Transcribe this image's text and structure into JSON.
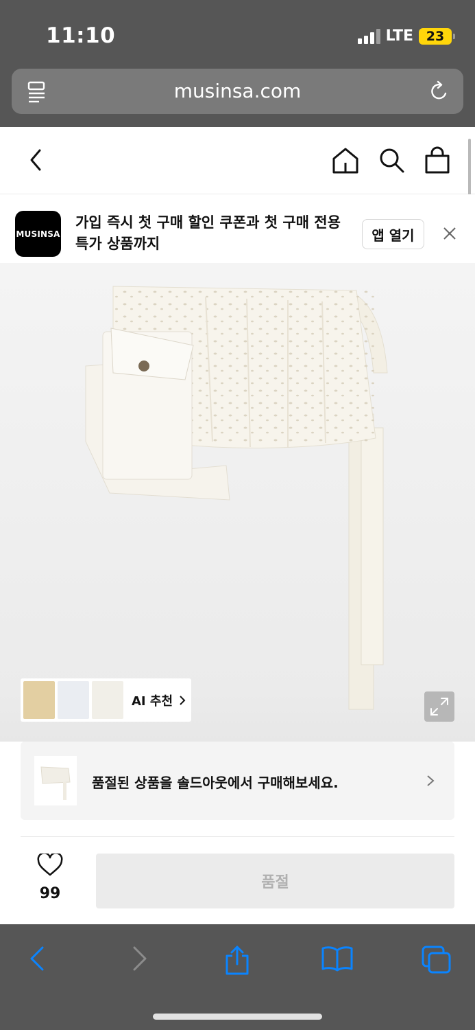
{
  "status_bar": {
    "time": "11:10",
    "network": "LTE",
    "battery": "23"
  },
  "browser": {
    "url": "musinsa.com"
  },
  "header": {
    "icons": [
      "back-arrow-icon",
      "home-icon",
      "search-icon",
      "shopping-bag-icon"
    ]
  },
  "promo": {
    "logo_text": "MUSINSA",
    "text": "가입 즉시 첫 구매 할인 쿠폰과 첫 구매 전용 특가 상품까지",
    "open_app_label": "앱 열기"
  },
  "ai_recommend": {
    "label": "AI 추천"
  },
  "soldout_card": {
    "text": "품절된 상품을 솔드아웃에서 구매해보세요."
  },
  "bottom_action": {
    "like_count": "99",
    "buy_label": "품절"
  },
  "colors": {
    "chrome": "#565656",
    "accent_blue": "#0a84ff",
    "battery_yellow": "#ffd60a",
    "soldout_button": "#ebebeb"
  }
}
